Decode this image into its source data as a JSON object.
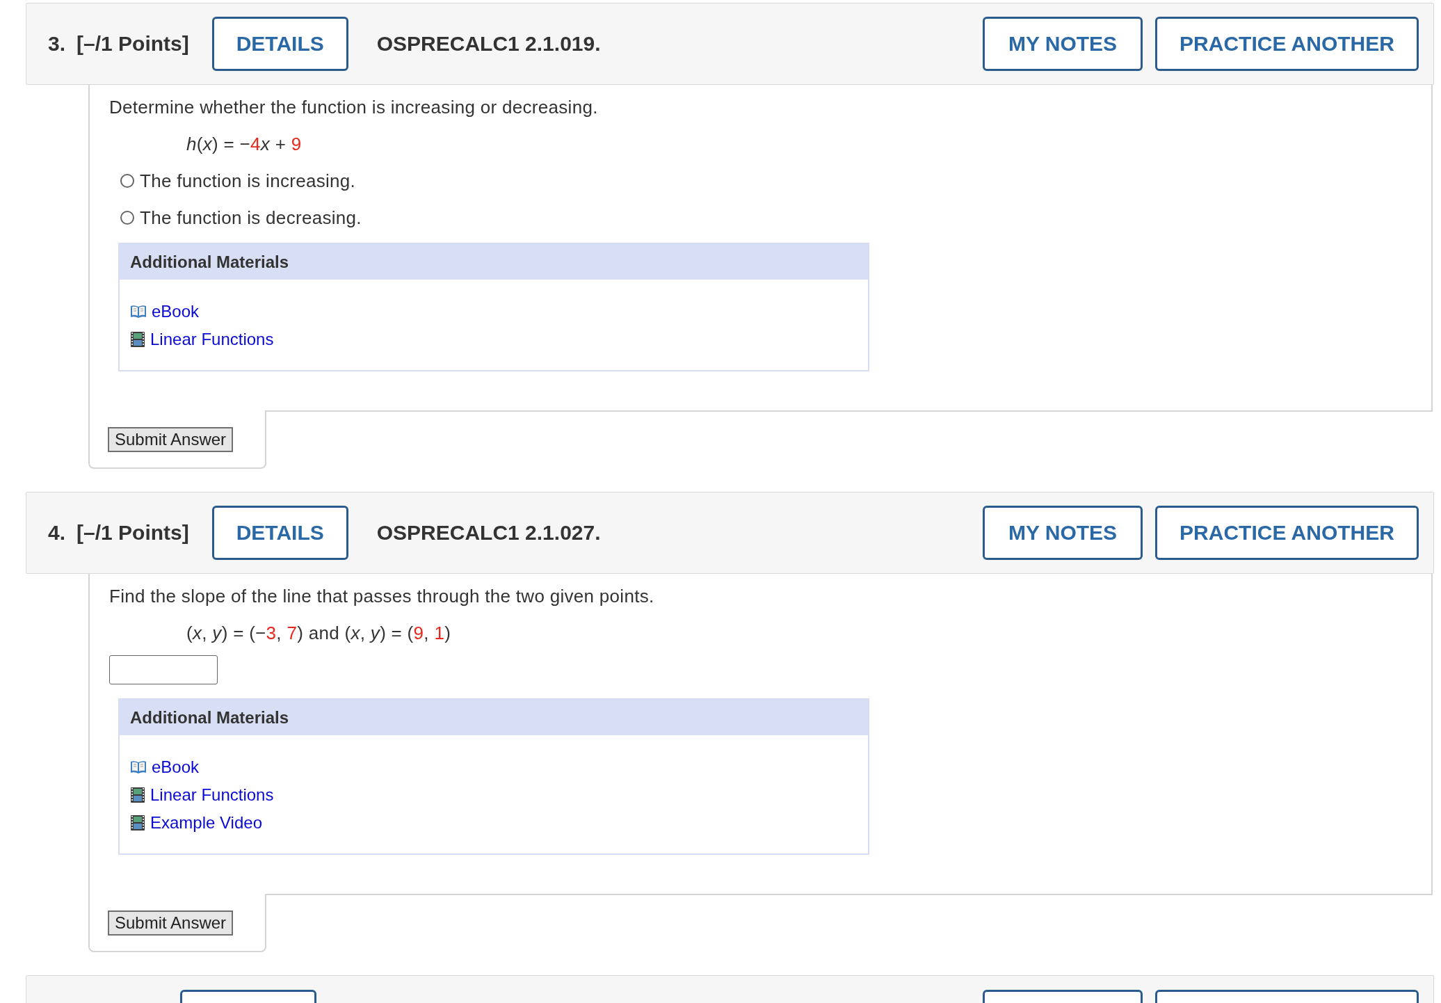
{
  "questions": [
    {
      "number": "3.",
      "points": "[–/1 Points]",
      "details_button": "DETAILS",
      "title": "OSPRECALC1 2.1.019.",
      "notes_button": "MY NOTES",
      "practice_button": "PRACTICE ANOTHER",
      "prompt": "Determine whether the function is increasing or decreasing.",
      "equation": [
        {
          "kind": "var",
          "text": "h"
        },
        {
          "kind": "op",
          "text": "("
        },
        {
          "kind": "var",
          "text": "x"
        },
        {
          "kind": "op",
          "text": ") = −"
        },
        {
          "kind": "num",
          "text": "4"
        },
        {
          "kind": "var",
          "text": "x"
        },
        {
          "kind": "op",
          "text": " + "
        },
        {
          "kind": "num",
          "text": "9"
        }
      ],
      "answer": {
        "kind": "radio",
        "options": [
          {
            "label": "The function is increasing.",
            "selected": false
          },
          {
            "label": "The function is decreasing.",
            "selected": false
          }
        ]
      },
      "materials": {
        "title": "Additional Materials",
        "links": [
          {
            "kind": "ebook",
            "label": "eBook"
          },
          {
            "kind": "video",
            "label": "Linear Functions"
          }
        ]
      },
      "submit_button": "Submit Answer"
    },
    {
      "number": "4.",
      "points": "[–/1 Points]",
      "details_button": "DETAILS",
      "title": "OSPRECALC1 2.1.027.",
      "notes_button": "MY NOTES",
      "practice_button": "PRACTICE ANOTHER",
      "prompt": "Find the slope of the line that passes through the two given points.",
      "equation": [
        {
          "kind": "op",
          "text": "("
        },
        {
          "kind": "var",
          "text": "x"
        },
        {
          "kind": "op",
          "text": ", "
        },
        {
          "kind": "var",
          "text": "y"
        },
        {
          "kind": "op",
          "text": ") = (−"
        },
        {
          "kind": "num",
          "text": "3"
        },
        {
          "kind": "op",
          "text": ", "
        },
        {
          "kind": "num",
          "text": "7"
        },
        {
          "kind": "op",
          "text": ") and ("
        },
        {
          "kind": "var",
          "text": "x"
        },
        {
          "kind": "op",
          "text": ", "
        },
        {
          "kind": "var",
          "text": "y"
        },
        {
          "kind": "op",
          "text": ") = ("
        },
        {
          "kind": "num",
          "text": "9"
        },
        {
          "kind": "op",
          "text": ", "
        },
        {
          "kind": "num",
          "text": "1"
        },
        {
          "kind": "op",
          "text": ")"
        }
      ],
      "answer": {
        "kind": "text"
      },
      "materials": {
        "title": "Additional Materials",
        "links": [
          {
            "kind": "ebook",
            "label": "eBook"
          },
          {
            "kind": "video",
            "label": "Linear Functions"
          },
          {
            "kind": "video",
            "label": "Example Video"
          }
        ]
      },
      "submit_button": "Submit Answer"
    }
  ],
  "next_header": {
    "buttons": [
      {
        "kind": "outline"
      },
      {
        "kind": "outline"
      },
      {
        "kind": "outline"
      }
    ]
  }
}
